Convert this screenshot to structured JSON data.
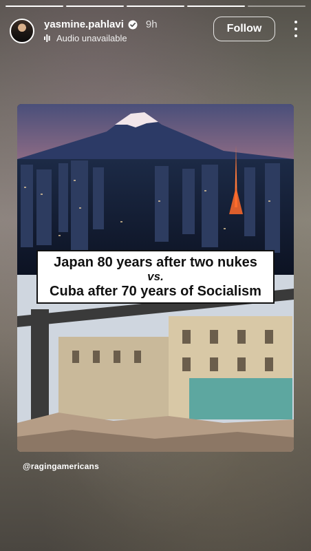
{
  "story": {
    "segments_total": 5,
    "segments_done": 4
  },
  "header": {
    "username": "yasmine.pahlavi",
    "verified": true,
    "time": "9h",
    "audio_status": "Audio unavailable",
    "follow_label": "Follow",
    "icons": [
      "avatar",
      "verified-badge-icon",
      "audio-bars-icon",
      "more-vertical-icon"
    ]
  },
  "post": {
    "caption_line1": "Japan 80 years after two nukes",
    "caption_line2": "vs.",
    "caption_line3": "Cuba after 70 years of Socialism",
    "handle": "@ragingamericans"
  },
  "colors": {
    "overlay_text": "#ffffff",
    "caption_bg": "#ffffff",
    "caption_text": "#111111"
  }
}
